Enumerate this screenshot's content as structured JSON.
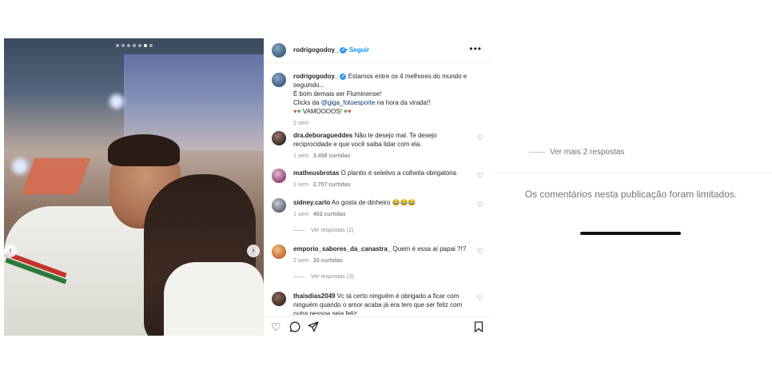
{
  "post": {
    "username": "rodrigogodoy_",
    "follow_separator": "•",
    "follow_label": "Seguir",
    "more_label": "•••",
    "caption": {
      "lines": [
        "Estamos entre os 4 melhores do mundo e seguindo...",
        "É bom demais ser Fluminense!",
        "Clicks da",
        "@giga_fotoesporte",
        "na hora da virada!!",
        "VAMOOOOS!"
      ],
      "time": "2 sem"
    },
    "comments": [
      {
        "username": "dra.deboragueddes",
        "text": "Não te desejo mal. Te desejo reciprocidade e que você saiba lidar com ela.",
        "time": "1 sem",
        "likes": "3.458 curtidas",
        "replies": ""
      },
      {
        "username": "matheusbrotas",
        "text": "O plantio é seletivo a colheita obrigatória",
        "time": "1 sem",
        "likes": "2.707 curtidas",
        "replies": ""
      },
      {
        "username": "sidney.carlo",
        "text": "Ao gosta de dinheiro 😂😂😂",
        "time": "1 sem",
        "likes": "402 curtidas",
        "replies": "Ver respostas (2)"
      },
      {
        "username": "emporio_sabores_da_canastra_",
        "text": "Quem é essa aí papai ?!?",
        "time": "2 sem",
        "likes": "20 curtidas",
        "replies": "Ver respostas (3)"
      },
      {
        "username": "thaisdias2049",
        "text": "Vc tá certo ninguém é obrigado a ficar com ninguém quando o amor acaba já era tem que ser feliz com outra pessoa seja feliz",
        "time": "",
        "likes": "",
        "replies": ""
      }
    ]
  },
  "right_panel": {
    "see_more": "Ver mais 2 respostas",
    "limited_notice": "Os comentários nesta publicação foram limitados."
  },
  "icons": {
    "heart": "heart-icon",
    "comment": "comment-icon",
    "share": "share-icon",
    "save": "bookmark-icon",
    "verified": "verified-badge-icon"
  },
  "colors": {
    "link_blue": "#0095f6",
    "verified_blue": "#3897f0",
    "mention": "#00376b",
    "muted": "#8e8e8e"
  }
}
